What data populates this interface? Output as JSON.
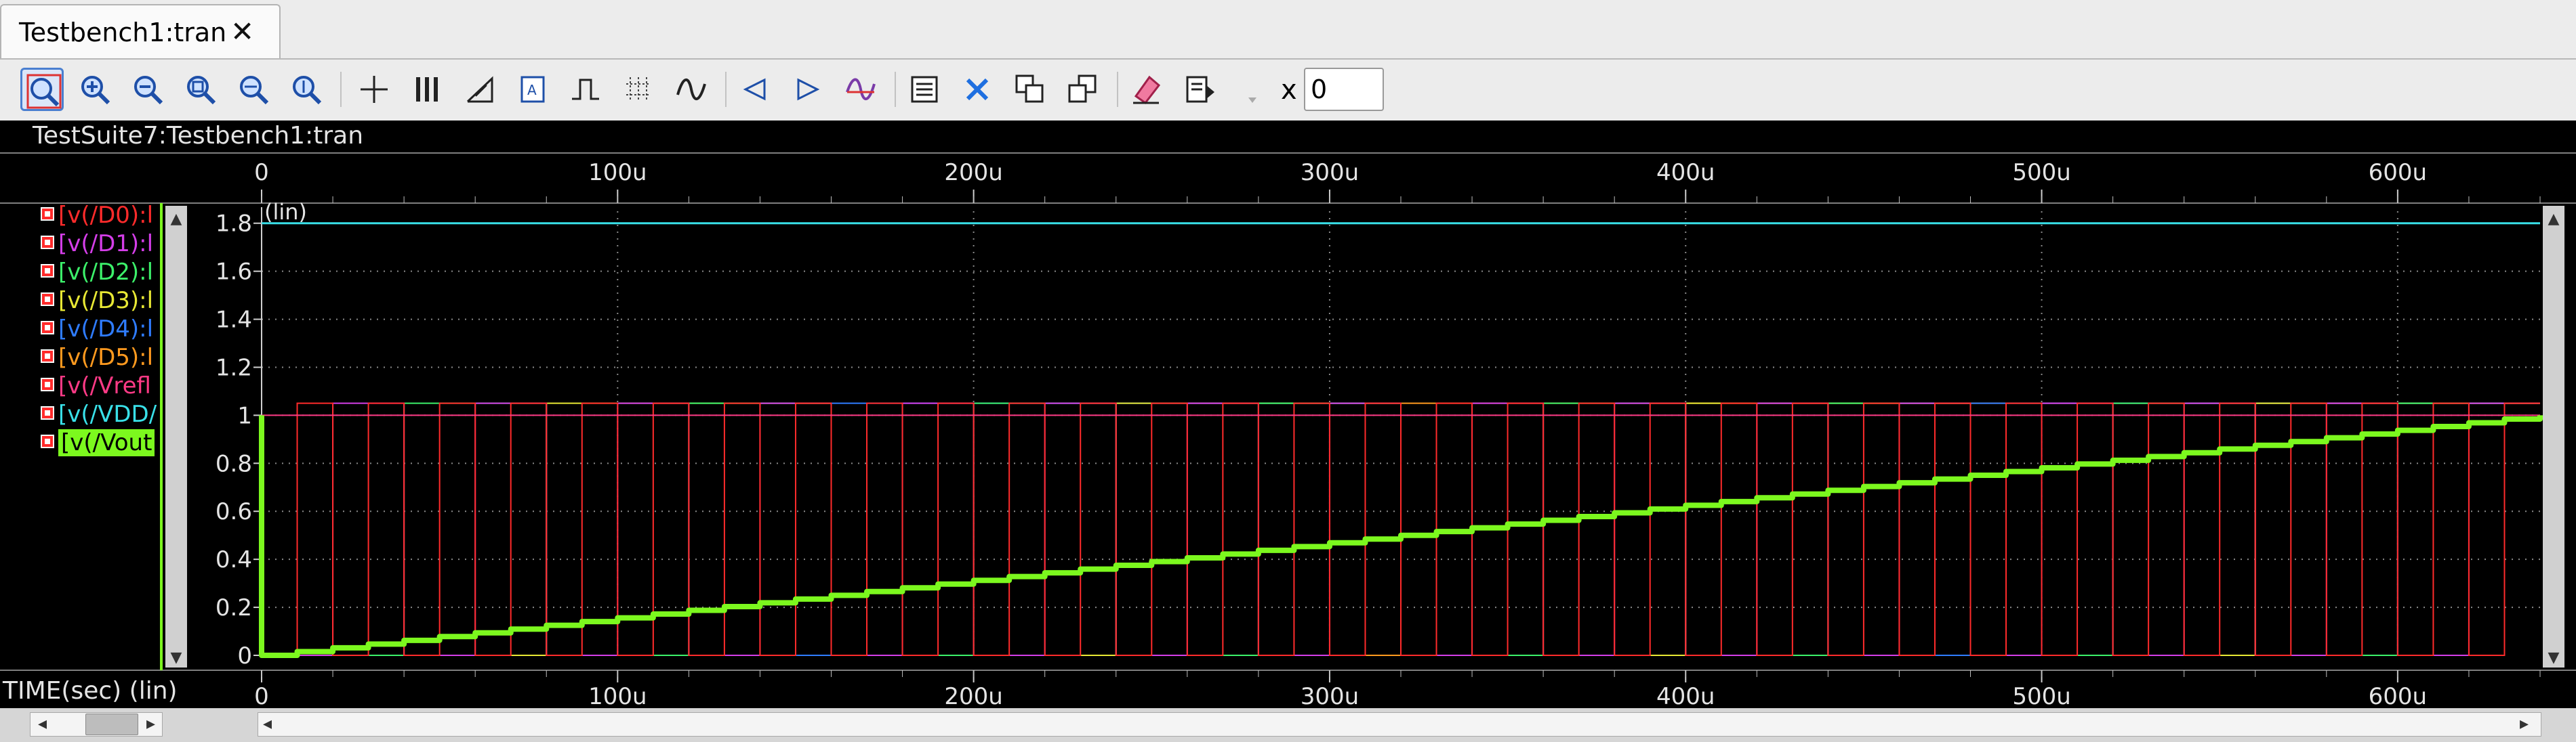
{
  "tab": {
    "title": "Testbench1:tran",
    "close": "✕"
  },
  "toolbar": {
    "x_label": "x",
    "x_value": "0",
    "buttons": [
      {
        "name": "zoom-fit",
        "icon": "zoom-fit-icon"
      },
      {
        "name": "zoom-in",
        "icon": "zoom-in-icon"
      },
      {
        "name": "zoom-out",
        "icon": "zoom-out-icon"
      },
      {
        "name": "zoom-box",
        "icon": "zoom-box-icon"
      },
      {
        "name": "zoom-x",
        "icon": "zoom-x-icon"
      },
      {
        "name": "zoom-y",
        "icon": "zoom-y-icon"
      },
      {
        "name": "crosshair",
        "icon": "crosshair-icon"
      },
      {
        "name": "vertical-marker",
        "icon": "vertical-marker-icon"
      },
      {
        "name": "delta-marker",
        "icon": "delta-marker-icon"
      },
      {
        "name": "annotate",
        "icon": "annotate-icon"
      },
      {
        "name": "pulse",
        "icon": "pulse-icon"
      },
      {
        "name": "grid",
        "icon": "grid-icon"
      },
      {
        "name": "waveform",
        "icon": "waveform-icon"
      },
      {
        "name": "previous",
        "icon": "triangle-left-icon"
      },
      {
        "name": "next",
        "icon": "triangle-right-icon"
      },
      {
        "name": "erase-waveform",
        "icon": "erase-waveform-icon"
      },
      {
        "name": "select-all",
        "icon": "select-all-icon"
      },
      {
        "name": "delete",
        "icon": "delete-x-icon"
      },
      {
        "name": "copy",
        "icon": "copy-icon"
      },
      {
        "name": "paste",
        "icon": "paste-icon"
      },
      {
        "name": "eraser",
        "icon": "eraser-icon"
      },
      {
        "name": "settings-list",
        "icon": "settings-list-icon"
      },
      {
        "name": "dropdown",
        "icon": "dropdown-arrow-icon"
      }
    ]
  },
  "plot": {
    "title": "TestSuite7:Testbench1:tran",
    "y_scale_label": "(lin)",
    "x_axis_label": "TIME(sec) (lin)",
    "legend": [
      {
        "label": "[v(/D0):l",
        "color": "#ff2b2b"
      },
      {
        "label": "[v(/D1):l",
        "color": "#d43ee8"
      },
      {
        "label": "[v(/D2):l",
        "color": "#3cf06a"
      },
      {
        "label": "[v(/D3):l",
        "color": "#e8e834"
      },
      {
        "label": "[v(/D4):l",
        "color": "#2f7cff"
      },
      {
        "label": "[v(/D5):l",
        "color": "#ff9a1f"
      },
      {
        "label": "[v(/Vrefl",
        "color": "#ff3a86"
      },
      {
        "label": "[v(/VDD/",
        "color": "#39e0e8"
      },
      {
        "label": "[v(/Vout",
        "color": "#000000",
        "selected": true
      }
    ]
  },
  "chart_data": {
    "type": "line",
    "title": "TestSuite7:Testbench1:tran",
    "xlabel": "TIME(sec) (lin)",
    "ylabel": "(lin)",
    "x_ticks": [
      "0",
      "100u",
      "200u",
      "300u",
      "400u",
      "500u",
      "600u"
    ],
    "y_ticks": [
      "0",
      "0.2",
      "0.4",
      "0.6",
      "0.8",
      "1",
      "1.2",
      "1.4",
      "1.6",
      "1.8"
    ],
    "xlim": [
      0,
      0.00064
    ],
    "ylim": [
      0,
      1.85
    ],
    "grid": true,
    "colors": {
      "D0": "#ff2b2b",
      "D1": "#d43ee8",
      "D2": "#3cf06a",
      "D3": "#e8e834",
      "D4": "#2f7cff",
      "D5": "#ff9a1f",
      "Vrefl": "#ff3a86",
      "VDD": "#39e0e8",
      "Vout": "#7cf81e"
    },
    "series": [
      {
        "name": "v(/D0)",
        "high": 1.05,
        "period": 2e-05
      },
      {
        "name": "v(/D1)",
        "high": 1.05,
        "period": 4e-05
      },
      {
        "name": "v(/D2)",
        "high": 1.05,
        "period": 8e-05
      },
      {
        "name": "v(/D3)",
        "high": 1.05,
        "period": 0.00016
      },
      {
        "name": "v(/D4)",
        "high": 1.05,
        "period": 0.00032
      },
      {
        "name": "v(/D5)",
        "high": 1.05,
        "period": 0.00064
      },
      {
        "name": "v(/Vrefl)",
        "value": 1.0
      },
      {
        "name": "v(/VDD)",
        "value": 1.8
      },
      {
        "name": "v(/Vout)",
        "x": [
          0,
          0.00064
        ],
        "y": [
          0,
          1.0
        ],
        "steps": 64
      }
    ]
  }
}
